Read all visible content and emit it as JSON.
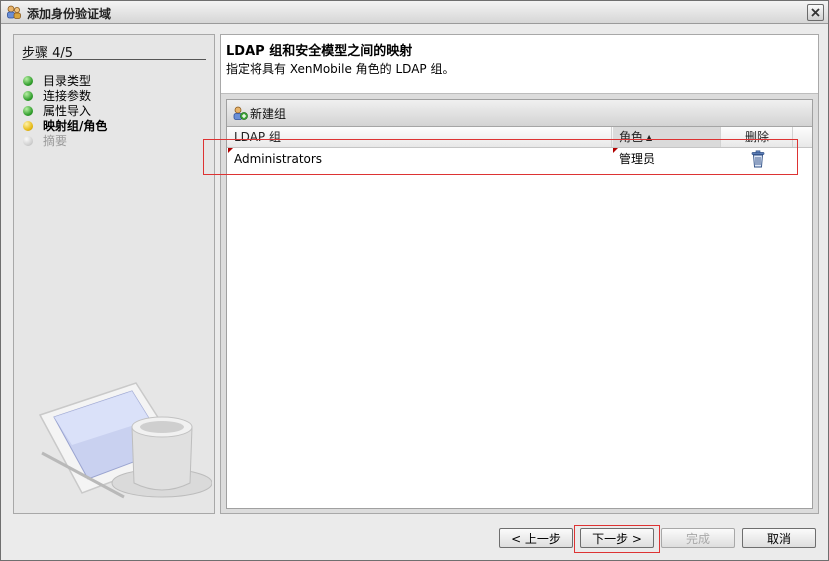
{
  "window": {
    "title": "添加身份验证域",
    "title_icon": "users-icon",
    "close_icon": "close-icon"
  },
  "wizard": {
    "step_label": "步骤 4/5",
    "steps": [
      {
        "label": "目录类型",
        "state": "done",
        "color": "#2e9c2a"
      },
      {
        "label": "连接参数",
        "state": "done",
        "color": "#2e9c2a"
      },
      {
        "label": "属性导入",
        "state": "done",
        "color": "#2e9c2a"
      },
      {
        "label": "映射组/角色",
        "state": "current",
        "color": "#e5b812"
      },
      {
        "label": "摘要",
        "state": "pending",
        "color": "#cfcfcf"
      }
    ]
  },
  "main": {
    "title": "LDAP 组和安全模型之间的映射",
    "subtitle": "指定将具有 XenMobile 角色的 LDAP 组。",
    "toolbar": {
      "new_group_label": "新建组",
      "new_group_icon": "add-group-icon"
    },
    "table": {
      "columns": [
        "LDAP 组",
        "角色",
        "删除"
      ],
      "sort_column": "角色",
      "sort_direction": "ascending",
      "rows": [
        {
          "ldap_group": "Administrators",
          "role": "管理员",
          "delete_icon": "trash-icon"
        }
      ]
    }
  },
  "buttons": {
    "back": "< 上一步",
    "next": "下一步 >",
    "finish": "完成",
    "cancel": "取消"
  },
  "colors": {
    "highlight_border": "#d33333",
    "step_done": "#2e9c2a",
    "step_current": "#e5b812"
  }
}
